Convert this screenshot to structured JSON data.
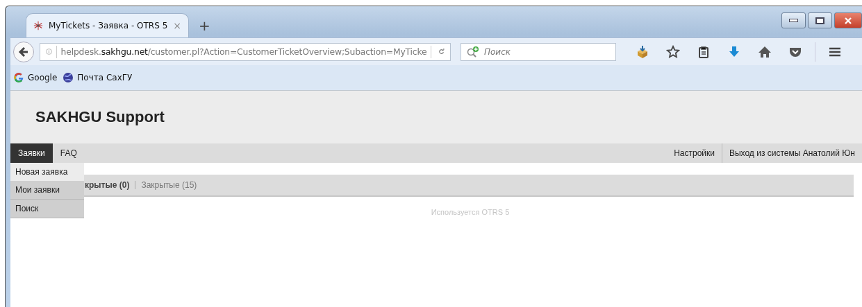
{
  "browser": {
    "tab": {
      "title": "MyTickets - Заявка - OTRS 5",
      "close": "×"
    },
    "new_tab": "+",
    "url": {
      "prefix": "helpdesk.",
      "domain": "sakhgu.net",
      "rest": "/customer.pl?Action=CustomerTicketOverview;Subaction=MyTicke"
    },
    "search": {
      "placeholder": "Поиск"
    },
    "bookmarks": [
      {
        "label": "Google",
        "kind": "google"
      },
      {
        "label": "Почта СахГУ",
        "kind": "globe"
      }
    ]
  },
  "page": {
    "brand": "SAKHGU Support",
    "nav_left": [
      {
        "label": "Заявки",
        "selected": true
      },
      {
        "label": "FAQ",
        "selected": false
      }
    ],
    "nav_right": [
      {
        "label": "Настройки"
      },
      {
        "label": "Выход из системы Анатолий Юн"
      }
    ],
    "dropdown": [
      {
        "label": "Новая заявка",
        "highlighted": true
      },
      {
        "label": "Мои заявки",
        "highlighted": false
      },
      {
        "label": "Поиск",
        "highlighted": false
      }
    ],
    "filters": [
      {
        "label": "крытые (0)",
        "selected": true
      },
      {
        "label": "Закрытые (15)",
        "selected": false
      }
    ],
    "footer": "Используется OTRS 5"
  }
}
